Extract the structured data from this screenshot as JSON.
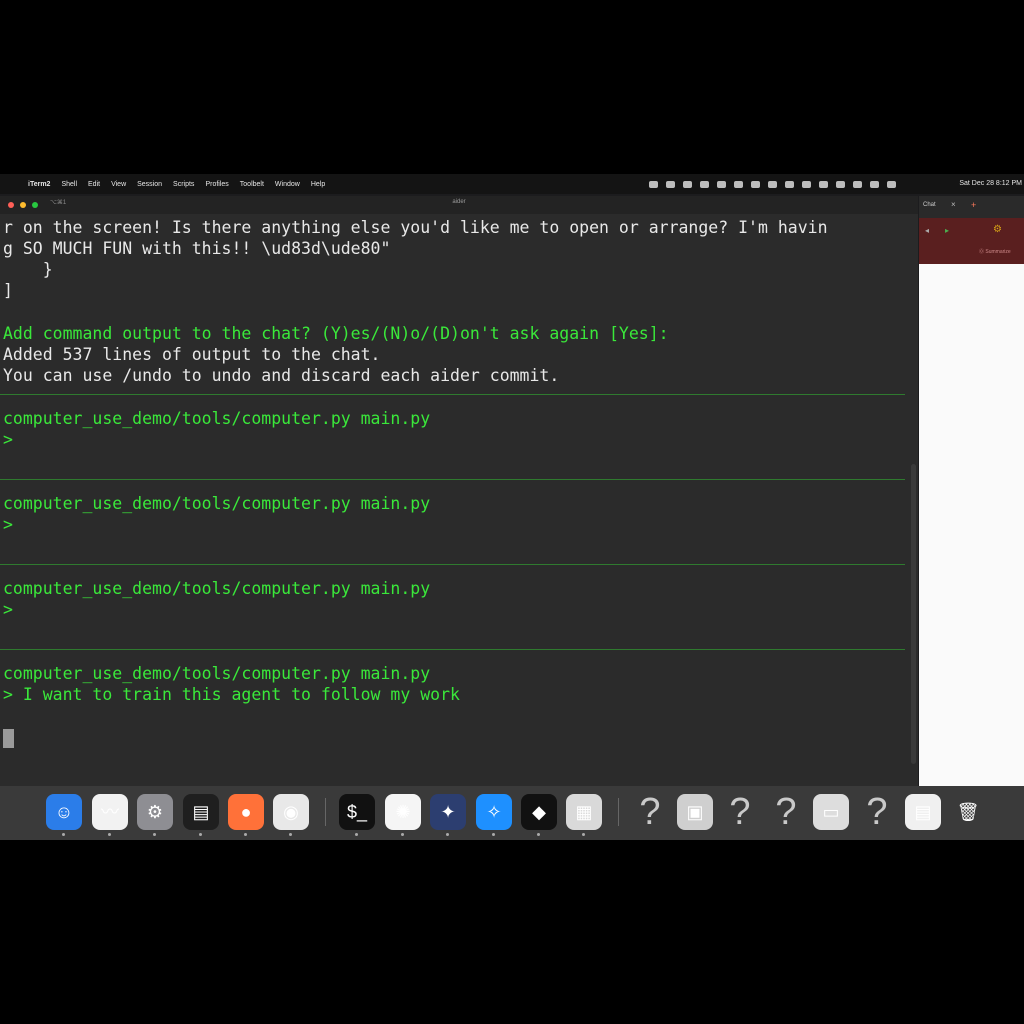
{
  "menubar": {
    "apple": "",
    "app": "iTerm2",
    "items": [
      "Shell",
      "Edit",
      "View",
      "Session",
      "Scripts",
      "Profiles",
      "Toolbelt",
      "Window",
      "Help"
    ],
    "clock": "Sat Dec 28  8:12 PM"
  },
  "terminal": {
    "tab": "⌥⌘1",
    "title": "aider",
    "lines": [
      "r on the screen! Is there anything else you'd like me to open or arrange? I'm havin",
      "g SO MUCH FUN with this!! \\ud83d\\ude80\"",
      "    }",
      "]",
      "Add command output to the chat? (Y)es/(N)o/(D)on't ask again [Yes]:",
      "Added 537 lines of output to the chat.",
      "You can use /undo to undo and discard each aider commit.",
      "computer_use_demo/tools/computer.py main.py",
      ">",
      "computer_use_demo/tools/computer.py main.py",
      ">",
      "computer_use_demo/tools/computer.py main.py",
      ">",
      "computer_use_demo/tools/computer.py main.py",
      "> I want to train this agent to follow my work"
    ]
  },
  "chat": {
    "tab": "Chat",
    "close": "×",
    "plus": "+",
    "url": "⓪ Summarize",
    "tools": [
      "◂",
      "▸",
      "⚙"
    ]
  },
  "dock": {
    "items": [
      {
        "name": "finder-icon",
        "glyph": "☺",
        "color": "#2b7de9"
      },
      {
        "name": "freeform-icon",
        "glyph": "〰",
        "color": "#f2f2f2"
      },
      {
        "name": "system-settings-icon",
        "glyph": "⚙",
        "color": "#8e8e93"
      },
      {
        "name": "activity-monitor-icon",
        "glyph": "▤",
        "color": "#1f1f1f"
      },
      {
        "name": "firefox-icon",
        "glyph": "●",
        "color": "#ff7139"
      },
      {
        "name": "chrome-icon",
        "glyph": "◉",
        "color": "#e8e8e8"
      },
      {
        "name": "terminal-icon",
        "glyph": "$_",
        "color": "#111111"
      },
      {
        "name": "chatgpt-icon",
        "glyph": "✺",
        "color": "#f5f5f5"
      },
      {
        "name": "xcode-instruments-icon",
        "glyph": "✦",
        "color": "#2c3e70"
      },
      {
        "name": "safari-icon",
        "glyph": "✧",
        "color": "#1e90ff"
      },
      {
        "name": "cursor-app-icon",
        "glyph": "◆",
        "color": "#111111"
      },
      {
        "name": "calculator-icon",
        "glyph": "▦",
        "color": "#d9d9d9"
      },
      {
        "name": "unknown-app-icon",
        "glyph": "?",
        "color": "transparent"
      },
      {
        "name": "preview-image-icon",
        "glyph": "▣",
        "color": "#cfcfcf"
      },
      {
        "name": "unknown-app-icon",
        "glyph": "?",
        "color": "transparent"
      },
      {
        "name": "unknown-app-icon",
        "glyph": "?",
        "color": "transparent"
      },
      {
        "name": "window-thumbnail-icon",
        "glyph": "▭",
        "color": "#dddddd"
      },
      {
        "name": "unknown-app-icon",
        "glyph": "?",
        "color": "transparent"
      },
      {
        "name": "document-icon",
        "glyph": "▤",
        "color": "#f0f0f0"
      },
      {
        "name": "trash-icon",
        "glyph": "🗑",
        "color": "transparent"
      }
    ]
  }
}
